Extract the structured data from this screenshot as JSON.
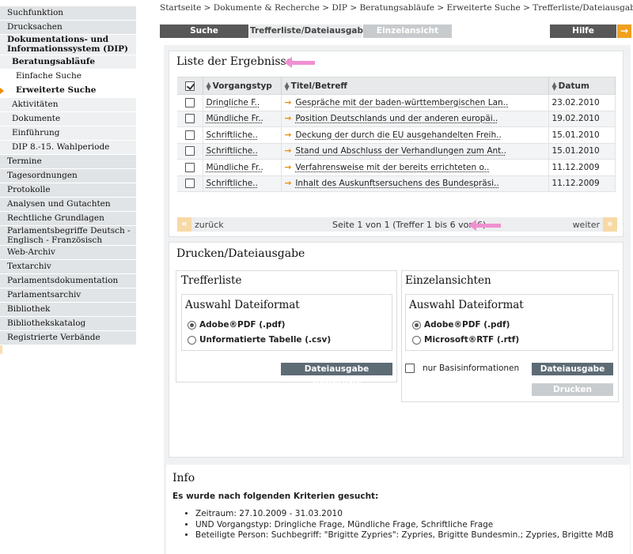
{
  "sidebar": {
    "items": [
      {
        "label": "Suchfunktion"
      },
      {
        "label": "Drucksachen"
      },
      {
        "label": "Dokumentations- und Informationssystem (DIP)"
      },
      {
        "label": "Beratungsabläufe"
      },
      {
        "label": "Einfache Suche"
      },
      {
        "label": "Erweiterte Suche"
      },
      {
        "label": "Aktivitäten"
      },
      {
        "label": "Dokumente"
      },
      {
        "label": "Einführung"
      },
      {
        "label": "DIP 8.-15. Wahlperiode"
      },
      {
        "label": "Termine"
      },
      {
        "label": "Tagesordnungen"
      },
      {
        "label": "Protokolle"
      },
      {
        "label": "Analysen und Gutachten"
      },
      {
        "label": "Rechtliche Grundlagen"
      },
      {
        "label": "Parlamentsbegriffe Deutsch - Englisch - Französisch"
      },
      {
        "label": "Web-Archiv"
      },
      {
        "label": "Textarchiv"
      },
      {
        "label": "Parlamentsdokumentation"
      },
      {
        "label": "Parlamentsarchiv"
      },
      {
        "label": "Bibliothek"
      },
      {
        "label": "Bibliothekskatalog"
      },
      {
        "label": "Registrierte Verbände"
      }
    ]
  },
  "breadcrumb": "Startseite > Dokumente & Recherche > DIP > Beratungsabläufe > Erweiterte Suche > Trefferliste/Dateiausgabe",
  "tabs": {
    "suche": "Suche",
    "treffer": "Trefferliste/Dateiausgabe",
    "einzel": "Einzelansicht",
    "hilfe": "Hilfe",
    "hilfe_arrow": "→"
  },
  "results": {
    "title": "Liste der Ergebnisse",
    "columns": {
      "typ": "Vorgangstyp",
      "titel": "Titel/Betreff",
      "datum": "Datum"
    },
    "rows": [
      {
        "typ": "Dringliche F..",
        "titel": "Gespräche mit der baden-württembergischen Lan..",
        "datum": "23.02.2010"
      },
      {
        "typ": "Mündliche Fr..",
        "titel": "Position Deutschlands und der anderen europäi..",
        "datum": "19.02.2010"
      },
      {
        "typ": "Schriftliche..",
        "titel": "Deckung der durch die EU ausgehandelten Freih..",
        "datum": "15.01.2010"
      },
      {
        "typ": "Schriftliche..",
        "titel": "Stand und Abschluss der Verhandlungen zum Ant..",
        "datum": "15.01.2010"
      },
      {
        "typ": "Mündliche Fr..",
        "titel": "Verfahrensweise mit der bereits errichteten o..",
        "datum": "11.12.2009"
      },
      {
        "typ": "Schriftliche..",
        "titel": "Inhalt des Auskunftsersuchens des Bundespräsi..",
        "datum": "11.12.2009"
      }
    ],
    "pager": {
      "prev_icon": "«",
      "prev": "zurück",
      "status": "Seite 1 von 1 (Treffer 1 bis 6 von 6)",
      "next": "weiter",
      "next_icon": "»"
    }
  },
  "print": {
    "title": "Drucken/Dateiausgabe",
    "left": {
      "title": "Trefferliste",
      "format_title": "Auswahl Dateiformat",
      "opt_pdf": "Adobe®PDF (.pdf)",
      "opt_csv": "Unformatierte Tabelle (.csv)",
      "button": "Dateiausgabe Trefferliste"
    },
    "right": {
      "title": "Einzelansichten",
      "format_title": "Auswahl Dateiformat",
      "opt_pdf": "Adobe®PDF (.pdf)",
      "opt_rtf": "Microsoft®RTF (.rtf)",
      "basis_label": "nur Basisinformationen",
      "button": "Dateiausgabe",
      "print_button": "Drucken"
    }
  },
  "info": {
    "title": "Info",
    "intro": "Es wurde nach folgenden Kriterien gesucht:",
    "criteria": [
      "Zeitraum: 27.10.2009 - 31.03.2010",
      "UND Vorgangstyp: Dringliche Frage, Mündliche Frage, Schriftliche Frage",
      "Beteiligte Person: Suchbegriff: \"Brigitte Zypries\": Zypries, Brigitte Bundesmin.; Zypries, Brigitte MdB"
    ]
  },
  "colors": {
    "accent": "#f08c00",
    "tab_dark": "#585858",
    "annotation": "#f090d0"
  }
}
